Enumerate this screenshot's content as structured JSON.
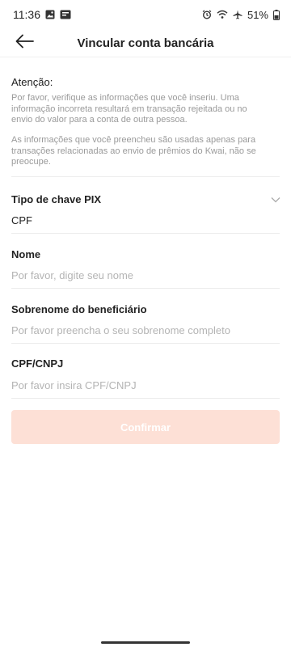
{
  "status_bar": {
    "time": "11:36",
    "battery": "51%",
    "left_icons": [
      "gallery-icon",
      "notification-badge-icon"
    ],
    "right_icons": [
      "alarm-icon",
      "wifi-icon",
      "airplane-icon",
      "battery-icon"
    ]
  },
  "header": {
    "back_icon": "arrow-left-icon",
    "title": "Vincular conta bancária"
  },
  "notice": {
    "title": "Atenção:",
    "paragraph_1": "Por favor, verifique as informações que você inseriu. Uma informação incorreta resultará em transação rejeitada ou no envio do valor para a conta de outra pessoa.",
    "paragraph_2": "As informações que você preencheu são usadas apenas para transações relacionadas ao envio de prêmios do Kwai, não se preocupe."
  },
  "form": {
    "pix_key_type": {
      "label": "Tipo de chave PIX",
      "value": "CPF",
      "icon": "chevron-down-icon"
    },
    "name": {
      "label": "Nome",
      "placeholder": "Por favor, digite seu nome",
      "value": ""
    },
    "surname": {
      "label": "Sobrenome do beneficiário",
      "placeholder": "Por favor preencha o seu sobrenome completo",
      "value": ""
    },
    "cpf_cnpj": {
      "label": "CPF/CNPJ",
      "placeholder": "Por favor insira CPF/CNPJ",
      "value": ""
    },
    "confirm_label": "Confirmar",
    "confirm_enabled": false
  },
  "colors": {
    "confirm_disabled_bg": "#fde0d6",
    "placeholder": "#b4b4b4",
    "notice_text": "#9a9a9a"
  }
}
